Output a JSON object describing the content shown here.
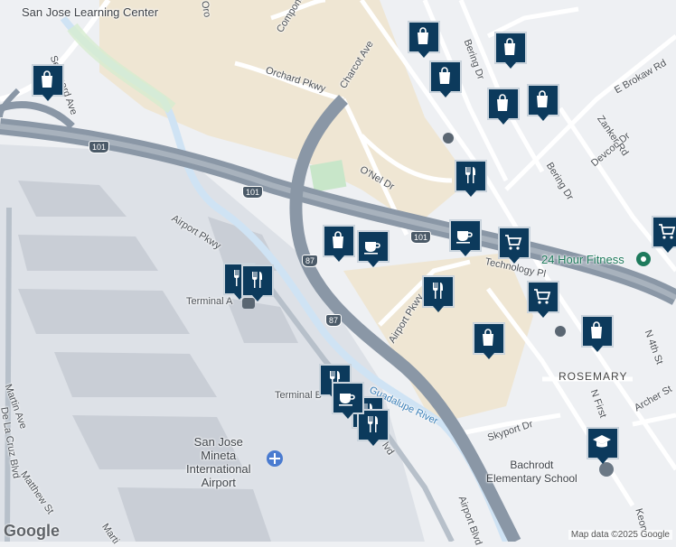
{
  "map": {
    "labels": {
      "learning_center": "San Jose Learning Center",
      "charcot": "Charcot Ave",
      "orchard": "Orchard Pkwy",
      "component": "Component",
      "o_nel": "O'Nel Dr",
      "bering_dr_1": "Bering Dr",
      "bering_dr_2": "Bering Dr",
      "devcon": "Devcon Dr",
      "zanker": "Zanker Rd",
      "brokaw": "E Brokaw Rd",
      "technology": "Technology Pl",
      "fitness": "24 Hour Fitness",
      "airport_pkwy_1": "Airport Pkwy",
      "airport_pkwy_2": "Airport Pkwy",
      "terminal_a": "Terminal A",
      "terminal_b": "Terminal B",
      "guadalupe": "Guadalupe River",
      "rosemary": "ROSEMARY",
      "n_fourth": "N 4th St",
      "n_first": "N First",
      "archer": "Archer St",
      "skyport": "Skyport Dr",
      "school_line1": "Bachrodt",
      "school_line2": "Elementary School",
      "airport_line1": "San Jose",
      "airport_line2": "Mineta",
      "airport_line3": "International",
      "airport_line4": "Airport",
      "martin": "Martin Ave",
      "de_la_cruz": "De La Cruz Blvd",
      "matthew": "Matthew St",
      "airport_blvd": "Airport Blvd",
      "blvd_frag": "lvd",
      "martin_frag": "Marti",
      "seaboard": "Seaboard Ave",
      "koen": "Keon",
      "oro": "Oro"
    },
    "shields": {
      "us101_a": "101",
      "us101_b": "101",
      "us101_c": "101",
      "ca87_a": "87",
      "ca87_b": "87"
    },
    "markers": [
      {
        "type": "shopping",
        "icon": "shopping-bag-icon"
      },
      {
        "type": "shopping",
        "icon": "shopping-bag-icon"
      },
      {
        "type": "shopping",
        "icon": "shopping-bag-icon"
      },
      {
        "type": "shopping",
        "icon": "shopping-bag-icon"
      },
      {
        "type": "shopping",
        "icon": "shopping-bag-icon"
      },
      {
        "type": "shopping",
        "icon": "shopping-bag-icon"
      },
      {
        "type": "shopping",
        "icon": "shopping-bag-icon"
      },
      {
        "type": "shopping",
        "icon": "shopping-bag-icon"
      },
      {
        "type": "shopping",
        "icon": "shopping-bag-icon"
      },
      {
        "type": "restaurant",
        "icon": "fork-knife-icon"
      },
      {
        "type": "restaurant",
        "icon": "fork-knife-icon"
      },
      {
        "type": "restaurant",
        "icon": "fork-knife-icon"
      },
      {
        "type": "restaurant",
        "icon": "fork-knife-icon"
      },
      {
        "type": "restaurant",
        "icon": "fork-knife-icon"
      },
      {
        "type": "restaurant",
        "icon": "fork-knife-icon"
      },
      {
        "type": "restaurant",
        "icon": "fork-knife-icon"
      },
      {
        "type": "cafe",
        "icon": "coffee-cup-icon"
      },
      {
        "type": "cafe",
        "icon": "coffee-cup-icon"
      },
      {
        "type": "cafe",
        "icon": "coffee-cup-icon"
      },
      {
        "type": "grocery",
        "icon": "shopping-cart-icon"
      },
      {
        "type": "grocery",
        "icon": "shopping-cart-icon"
      },
      {
        "type": "grocery",
        "icon": "shopping-cart-icon"
      },
      {
        "type": "school",
        "icon": "graduation-cap-icon"
      }
    ],
    "attribution": "Map data ©2025 Google",
    "logo": "Google"
  },
  "colors": {
    "water": "#cfe3f4",
    "freeway": "#8a97a6",
    "industrial": "#efe6d3",
    "park": "#c8e6c9",
    "marker": "#0c3a5c",
    "poi_green": "#1e7a5c"
  }
}
